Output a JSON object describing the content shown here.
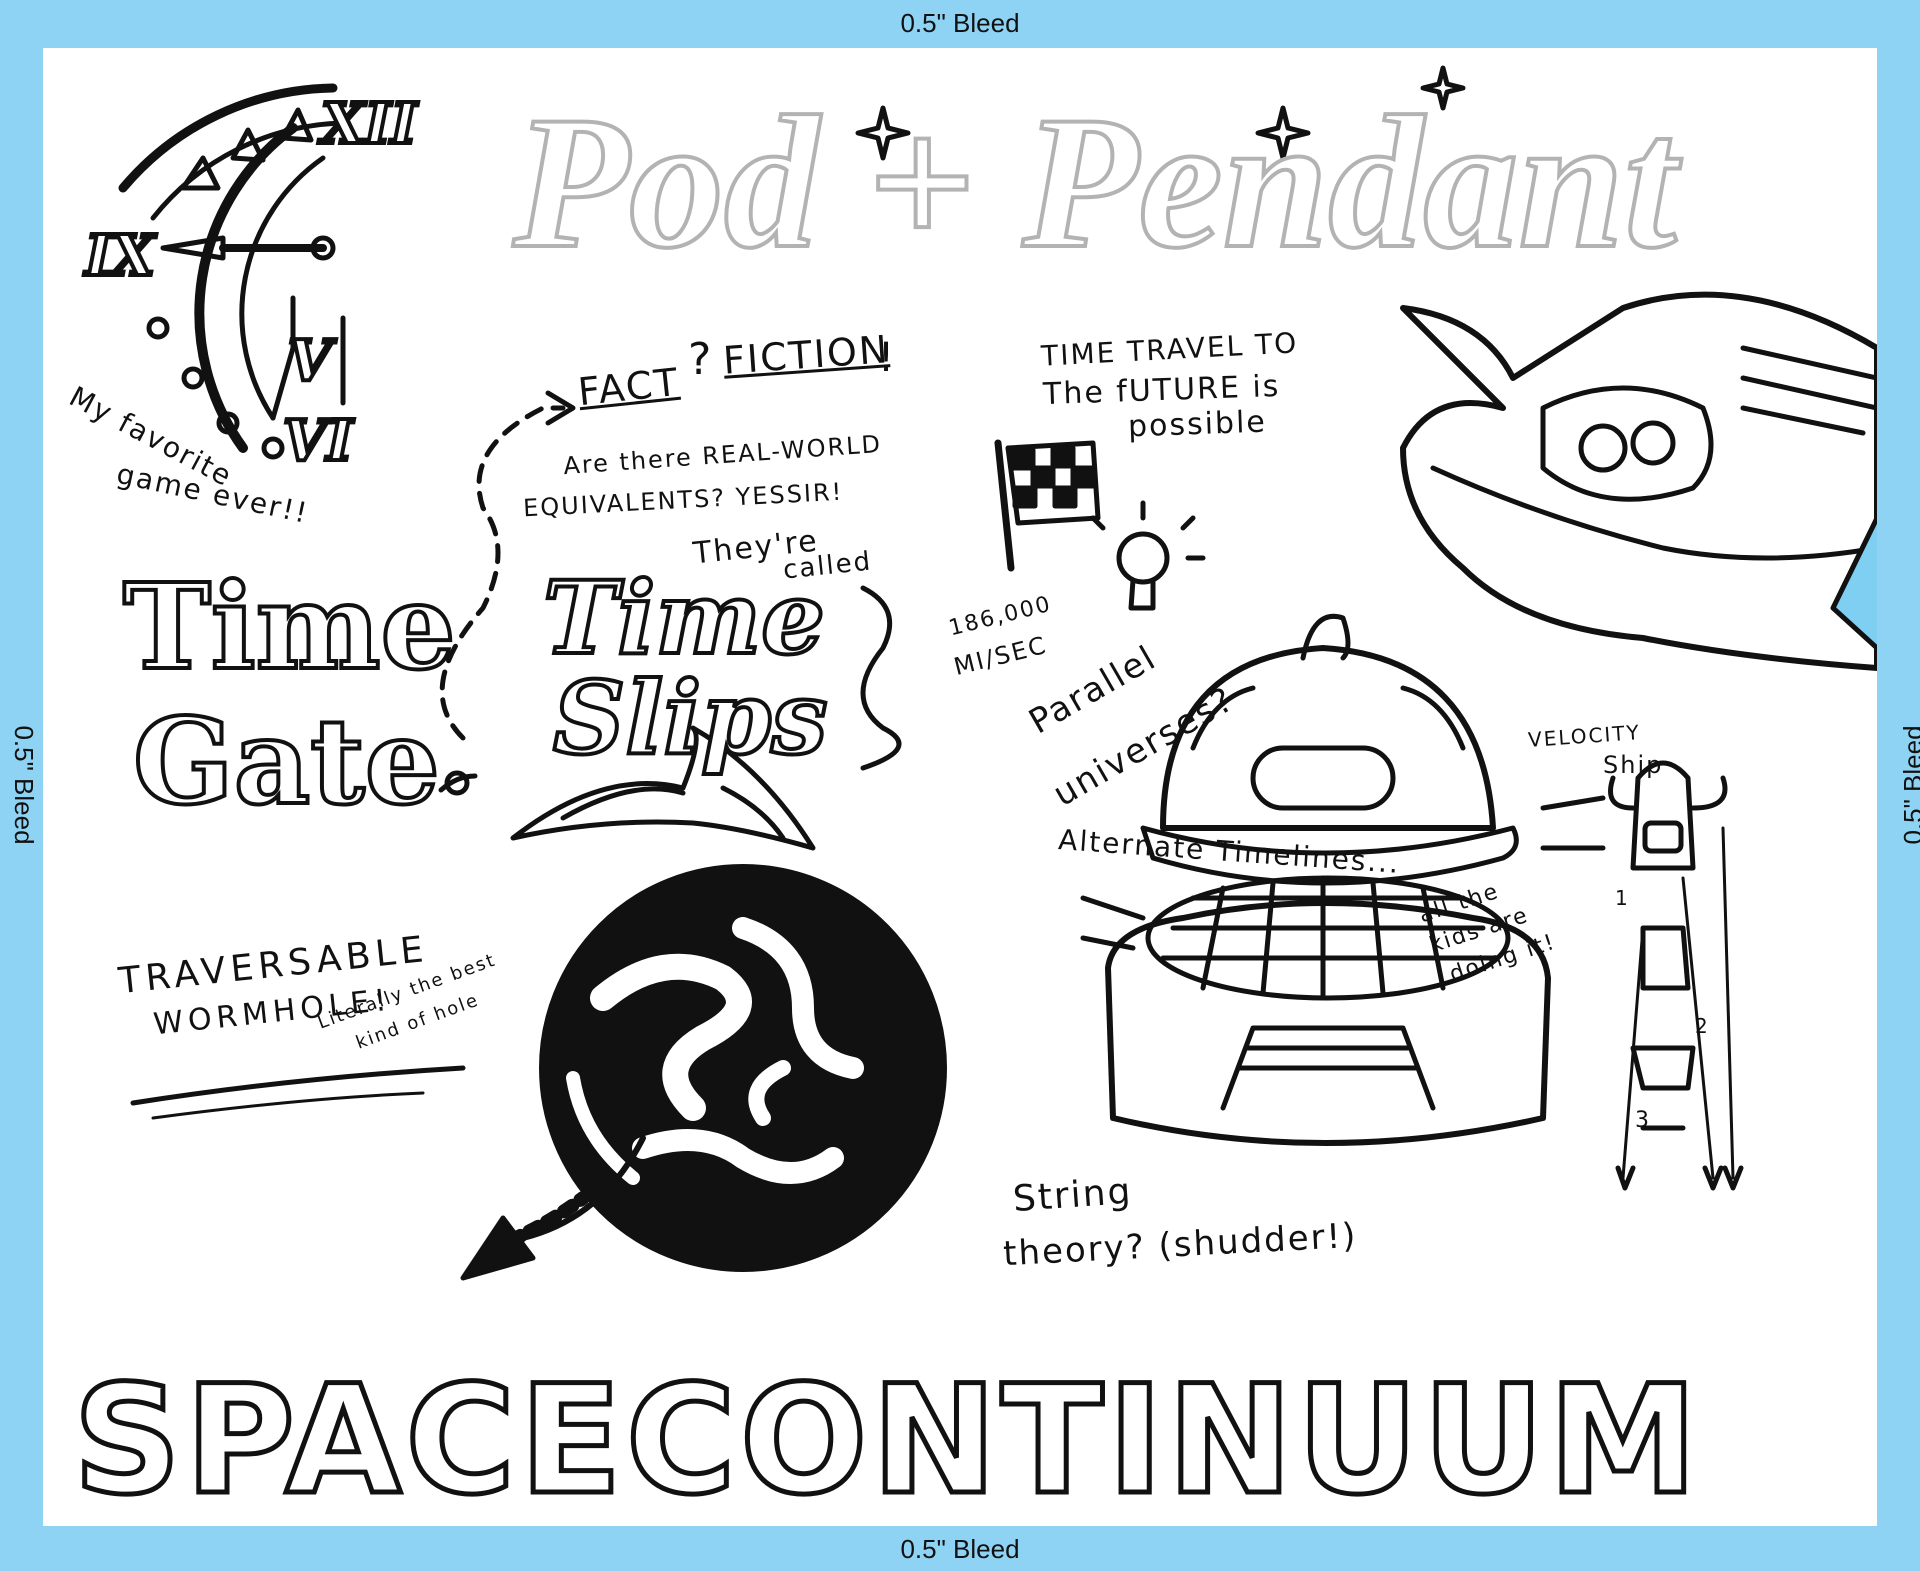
{
  "bleed": {
    "top": "0.5\" Bleed",
    "bottom": "0.5\" Bleed",
    "left": "0.5\" Bleed",
    "right": "0.5\" Bleed"
  },
  "header": {
    "title": "Pod + Pendant"
  },
  "clock": {
    "numerals": [
      "XII",
      "IX",
      "V",
      "VI"
    ],
    "caption_line1": "My favorite",
    "caption_line2": "game ever!!"
  },
  "fact_fiction": {
    "fact": "FACT",
    "question": "?",
    "fiction": "FICTION",
    "exclaim": "!",
    "line1": "Are there REAL-WORLD",
    "line2": "EQUIVALENTS?  YESSIR!"
  },
  "time_gate": {
    "line1": "Time",
    "line2": "Gate"
  },
  "time_slips": {
    "intro_line1": "They're",
    "intro_line2": "called",
    "line1": "Time",
    "line2": "Slips"
  },
  "future": {
    "line1": "TIME TRAVEL TO",
    "line2": "The fUTURE is",
    "line3": "possible",
    "speed_line1": "186,000",
    "speed_line2": "MI/SEC"
  },
  "parallel": {
    "line1": "Parallel",
    "line2": "universes?",
    "timelines": "Alternate Timelines...",
    "kids_line1": "all the",
    "kids_line2": "kids are",
    "kids_line3": "doing it!"
  },
  "velocity": {
    "line1": "VELOCITY",
    "line2": "Ship",
    "steps": [
      "1",
      "2",
      "3"
    ]
  },
  "wormhole": {
    "line1": "TRAVERSABLE",
    "line2": "WORMHOLE!",
    "note_line1": "Literally the best",
    "note_line2": "kind of hole"
  },
  "string_theory": {
    "line1": "String",
    "line2": "theory? (shudder!)"
  },
  "footer": {
    "title": "SPACECONTINUUM"
  },
  "colors": {
    "bleed": "#8fd3f4",
    "ink": "#111111",
    "title_gray": "#b3b3b3",
    "ship_blue": "#7ecff2"
  },
  "icons": [
    "checkered-flag-icon",
    "light-bulb-icon",
    "spaceship-illustration",
    "wormhole-illustration",
    "time-pod-illustration",
    "clock-illustration"
  ]
}
